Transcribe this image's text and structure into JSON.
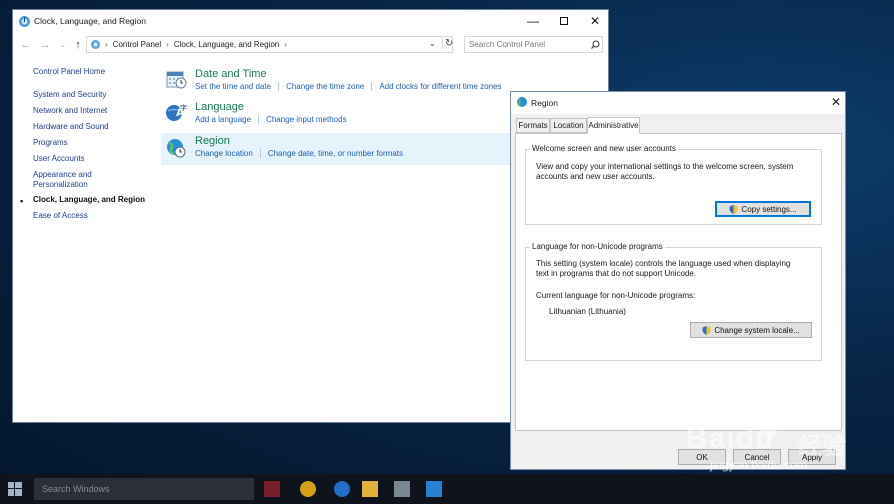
{
  "control_panel": {
    "title": "Clock, Language, and Region",
    "address": [
      "Control Panel",
      "Clock, Language, and Region"
    ],
    "search_placeholder": "Search Control Panel",
    "sidebar": {
      "home": "Control Panel Home",
      "items": [
        "System and Security",
        "Network and Internet",
        "Hardware and Sound",
        "Programs",
        "User Accounts",
        "Appearance and",
        "Personalization",
        "Clock, Language, and Region",
        "Ease of Access"
      ]
    },
    "categories": [
      {
        "title": "Date and Time",
        "links": [
          "Set the time and date",
          "Change the time zone",
          "Add clocks for different time zones"
        ]
      },
      {
        "title": "Language",
        "links": [
          "Add a language",
          "Change input methods"
        ]
      },
      {
        "title": "Region",
        "links": [
          "Change location",
          "Change date, time, or number formats"
        ]
      }
    ]
  },
  "region_dialog": {
    "title": "Region",
    "tabs": [
      "Formats",
      "Location",
      "Administrative"
    ],
    "welcome_group": {
      "title": "Welcome screen and new user accounts",
      "desc_line1": "View and copy your international settings to the welcome screen, system",
      "desc_line2": "accounts and new user accounts.",
      "button": "Copy settings..."
    },
    "unicode_group": {
      "title": "Language for non-Unicode programs",
      "desc_line1": "This setting (system locale) controls the language used when displaying",
      "desc_line2": "text in programs that do not support Unicode.",
      "current_label": "Current language for non-Unicode programs:",
      "current_value": "Lithuanian (Lithuania)",
      "button": "Change system locale..."
    },
    "footer_buttons": [
      "OK",
      "Cancel",
      "Apply"
    ]
  },
  "taskbar": {
    "search_placeholder": "Search Windows"
  },
  "watermark": {
    "brand": "Baidu",
    "brand_cn": "经验",
    "url": "jingyan.baidu.com"
  },
  "colors": {
    "link": "#1e5fb4",
    "category_title": "#1a7a50",
    "highlight_row": "#e5f3fb",
    "accent": "#0078d7"
  }
}
